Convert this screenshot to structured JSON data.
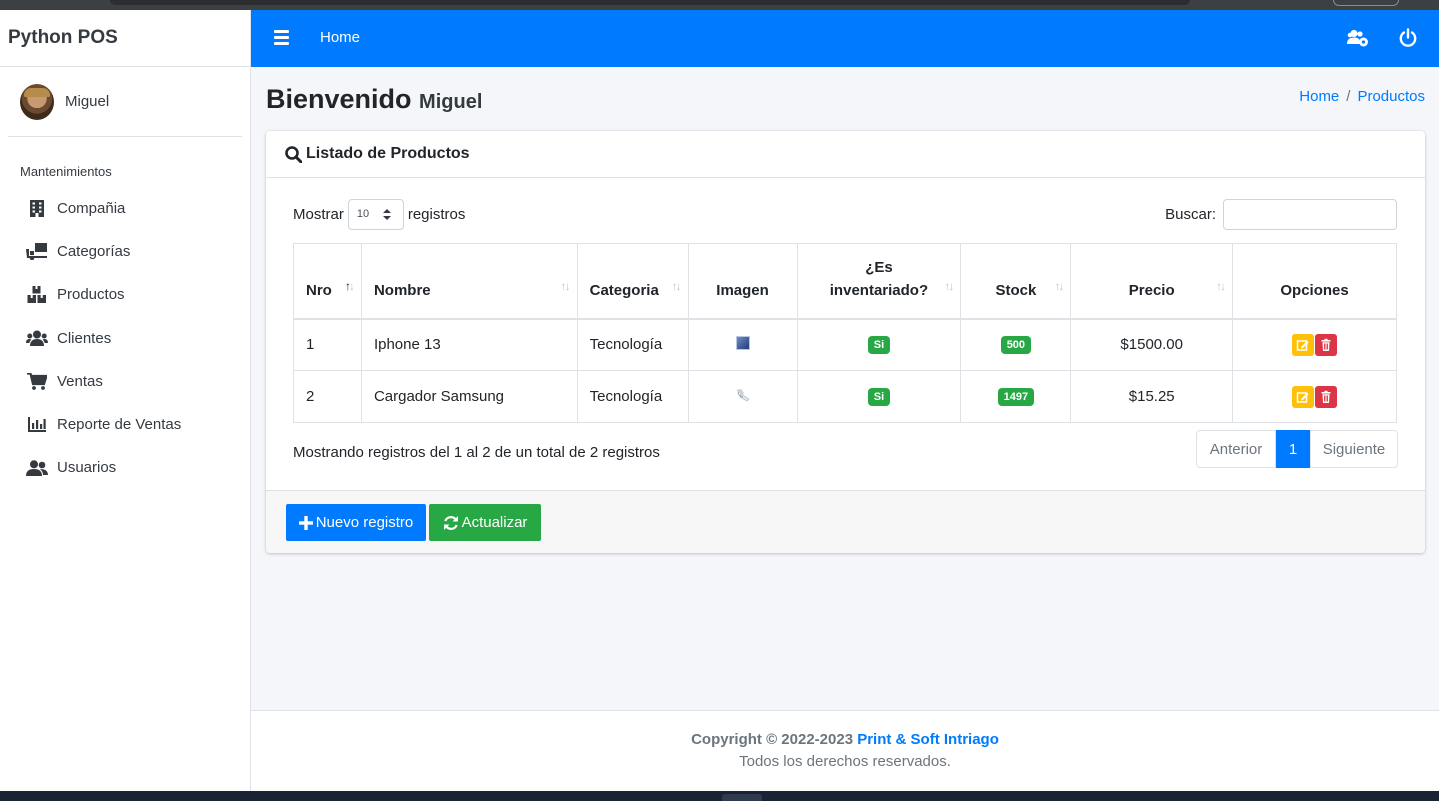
{
  "brand": "Python POS",
  "user": {
    "name": "Miguel"
  },
  "sidebar": {
    "header": "Mantenimientos",
    "items": [
      {
        "label": "Compañia",
        "icon": "building-icon"
      },
      {
        "label": "Categorías",
        "icon": "truck-loading-icon"
      },
      {
        "label": "Productos",
        "icon": "boxes-icon"
      },
      {
        "label": "Clientes",
        "icon": "users-icon"
      },
      {
        "label": "Ventas",
        "icon": "cart-icon"
      },
      {
        "label": "Reporte de Ventas",
        "icon": "chart-bar-icon"
      },
      {
        "label": "Usuarios",
        "icon": "user-friends-icon"
      }
    ]
  },
  "topbar": {
    "home": "Home"
  },
  "page": {
    "title": "Bienvenido",
    "subtitle": "Miguel",
    "breadcrumb": [
      "Home",
      "Productos"
    ]
  },
  "card": {
    "title": "Listado de Productos",
    "show_label": "Mostrar",
    "show_value": "10",
    "records_label": "registros",
    "search_label": "Buscar:",
    "search_value": "",
    "columns": [
      "Nro",
      "Nombre",
      "Categoria",
      "Imagen",
      "¿Es inventariado?",
      "Stock",
      "Precio",
      "Opciones"
    ],
    "rows": [
      {
        "nro": "1",
        "nombre": "Iphone 13",
        "categoria": "Tecnología",
        "inventariado": "Si",
        "stock": "500",
        "precio": "$1500.00"
      },
      {
        "nro": "2",
        "nombre": "Cargador Samsung",
        "categoria": "Tecnología",
        "inventariado": "Si",
        "stock": "1497",
        "precio": "$15.25"
      }
    ],
    "info": "Mostrando registros del 1 al 2 de un total de 2 registros",
    "pager": {
      "prev": "Anterior",
      "current": "1",
      "next": "Siguiente"
    },
    "buttons": {
      "new": "Nuevo registro",
      "refresh": "Actualizar"
    }
  },
  "footer": {
    "copyright": "Copyright © 2022-2023",
    "company": "Print & Soft Intriago",
    "rights": "Todos los derechos reservados."
  },
  "colors": {
    "primary": "#007bff",
    "success": "#28a745",
    "warning": "#ffc107",
    "danger": "#dc3545"
  }
}
